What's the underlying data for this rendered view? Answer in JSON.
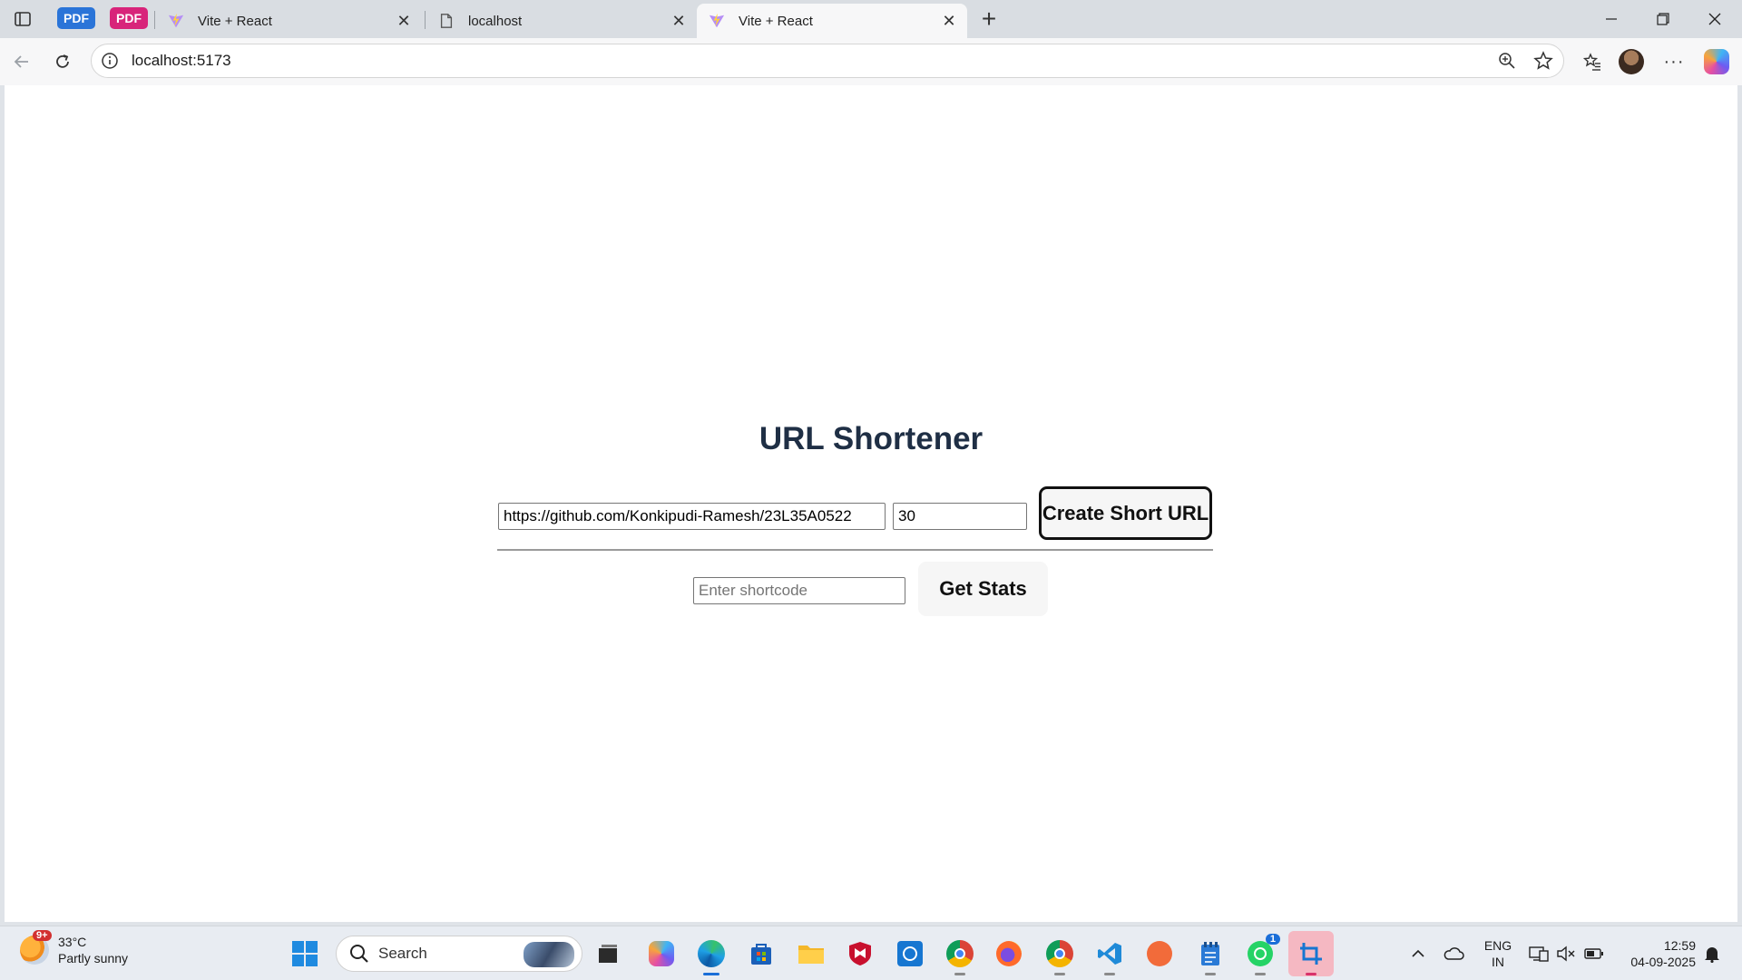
{
  "browser": {
    "tabs": [
      {
        "title": "Vite + React",
        "favicon": "vite-icon"
      },
      {
        "title": "localhost",
        "favicon": "page-icon"
      },
      {
        "title": "Vite + React",
        "favicon": "vite-icon",
        "active": true
      }
    ],
    "pdf_tabs": [
      "PDF",
      "PDF"
    ],
    "address": "localhost:5173"
  },
  "app": {
    "title": "URL Shortener",
    "long_url_value": "https://github.com/Konkipudi-Ramesh/23L35A0522",
    "validity_value": "30",
    "create_button": "Create Short URL",
    "shortcode_placeholder": "Enter shortcode",
    "stats_button": "Get Stats"
  },
  "taskbar": {
    "weather_temp": "33°C",
    "weather_desc": "Partly sunny",
    "weather_badge": "9+",
    "search_label": "Search",
    "lang_line1": "ENG",
    "lang_line2": "IN",
    "time": "12:59",
    "date": "04-09-2025",
    "whatsapp_badge": "1"
  },
  "colors": {
    "accent": "#1a6ed8",
    "title": "#1f2f45",
    "pdf_blue": "#2a74d8",
    "pdf_pink": "#d8247a"
  }
}
